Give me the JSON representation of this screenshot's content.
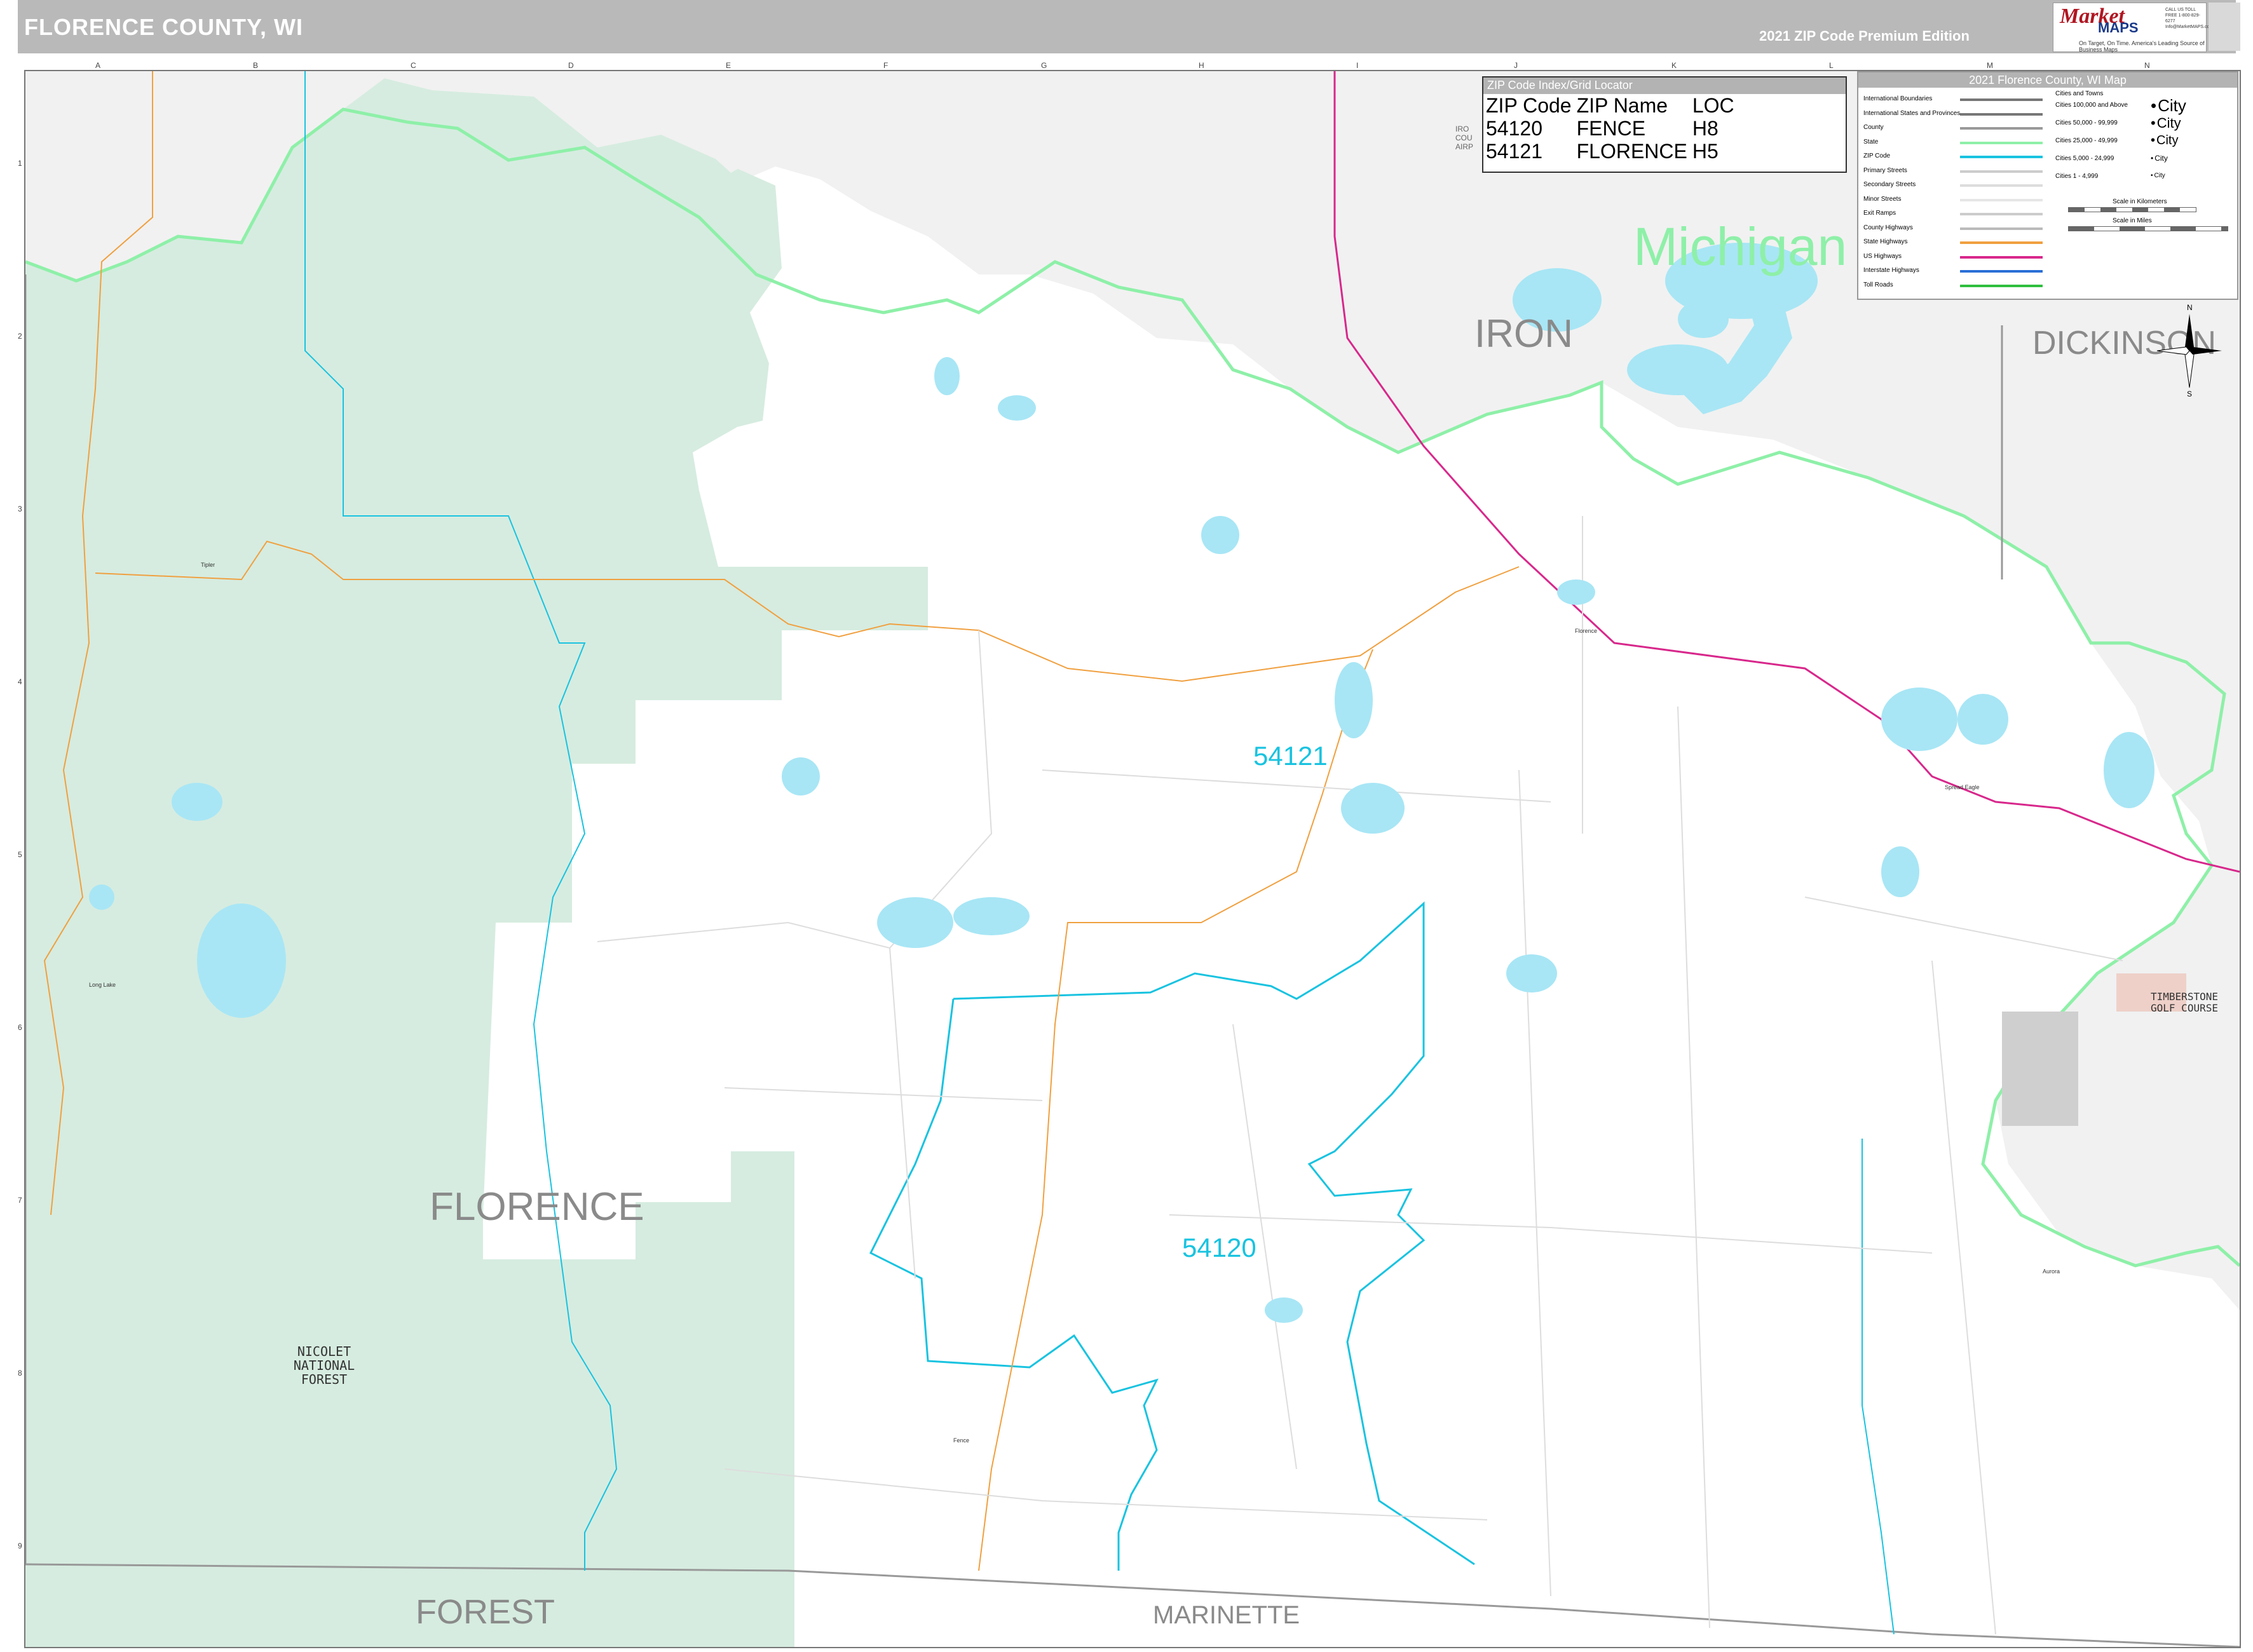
{
  "header": {
    "title": "FLORENCE COUNTY, WI",
    "edition": "2021 ZIP Code Premium Edition"
  },
  "logo": {
    "brand_top": "Market",
    "brand_bottom": "MAPS",
    "tagline": "On Target, On Time. America's Leading Source of Business Maps",
    "phone": "CALL US TOLL FREE 1-800-829-6277 Info@MarketMAPS.com"
  },
  "grid": {
    "columns": [
      "A",
      "B",
      "C",
      "D",
      "E",
      "F",
      "G",
      "H",
      "I",
      "J",
      "K",
      "L",
      "M",
      "N"
    ],
    "rows": [
      "1",
      "2",
      "3",
      "4",
      "5",
      "6",
      "7",
      "8",
      "9"
    ]
  },
  "zip_index": {
    "header": "ZIP Code Index/Grid Locator",
    "columns": [
      "ZIP Code",
      "ZIP Name",
      "LOC"
    ],
    "rows": [
      [
        "54120",
        "FENCE",
        "H8"
      ],
      [
        "54121",
        "FLORENCE",
        "H5"
      ]
    ]
  },
  "legend": {
    "header": "2021 Florence County, WI Map",
    "line_items": [
      {
        "label": "International Boundaries",
        "color": "#777777"
      },
      {
        "label": "International States and Provinces",
        "color": "#777777"
      },
      {
        "label": "County",
        "color": "#999999"
      },
      {
        "label": "State",
        "color": "#8ef0a8"
      },
      {
        "label": "ZIP Code",
        "color": "#19c3e0"
      },
      {
        "label": "Primary Streets",
        "color": "#cccccc"
      },
      {
        "label": "Secondary Streets",
        "color": "#dddddd"
      },
      {
        "label": "Minor Streets",
        "color": "#e6e6e6"
      },
      {
        "label": "Exit Ramps",
        "color": "#cccccc"
      },
      {
        "label": "County Highways",
        "color": "#bbbbbb"
      },
      {
        "label": "State Highways",
        "color": "#f0a040"
      },
      {
        "label": "US Highways",
        "color": "#d8288c"
      },
      {
        "label": "Interstate Highways",
        "color": "#2a6fd6"
      },
      {
        "label": "Toll Roads",
        "color": "#2fbf3f"
      }
    ],
    "city_header": "Cities and Towns",
    "city_items": [
      {
        "label": "Cities 100,000 and Above",
        "sample": "City"
      },
      {
        "label": "Cities 50,000 - 99,999",
        "sample": "City"
      },
      {
        "label": "Cities 25,000 - 49,999",
        "sample": "City"
      },
      {
        "label": "Cities 5,000 - 24,999",
        "sample": "City"
      },
      {
        "label": "Cities 1 - 4,999",
        "sample": "City"
      }
    ],
    "scale_km": "Scale in Kilometers",
    "scale_mi": "Scale in Miles"
  },
  "labels": {
    "county_main": "FLORENCE",
    "county_north": "IRON",
    "county_east": "DICKINSON",
    "county_south_west": "FOREST",
    "county_south_east": "MARINETTE",
    "state": "Michigan",
    "forest": "NICOLET NATIONAL FOREST",
    "golf": "TIMBERSTONE GOLF COURSE",
    "airport_fragment": "IRO COU AIRP"
  },
  "zips": [
    {
      "code": "54121"
    },
    {
      "code": "54120"
    }
  ],
  "places": [
    "Long Lake",
    "Fence",
    "Florence",
    "Spread Eagle",
    "Aurora",
    "Tipler"
  ],
  "colors": {
    "background_outside": "#f1f1f1",
    "county_fill": "#ffffff",
    "forest_fill": "#d6ece0",
    "water": "#a8e6f5",
    "state_line": "#8ef0a8",
    "zip_line": "#19c3e0",
    "us_highway": "#d8288c",
    "state_highway": "#f0a040"
  }
}
